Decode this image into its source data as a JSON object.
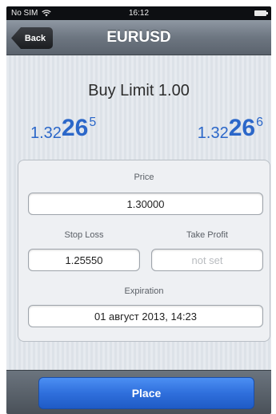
{
  "status_bar": {
    "carrier": "No SIM",
    "time": "16:12",
    "wifi_icon": "wifi-icon",
    "battery_icon": "battery-icon"
  },
  "nav": {
    "back_label": "Back",
    "title": "EURUSD"
  },
  "order": {
    "title": "Buy Limit 1.00"
  },
  "quotes": {
    "bid": {
      "base": "1.32",
      "big": "26",
      "sup": "5"
    },
    "ask": {
      "base": "1.32",
      "big": "26",
      "sup": "6"
    },
    "color": "#2b67c9"
  },
  "form": {
    "price_label": "Price",
    "price_value": "1.30000",
    "stop_loss_label": "Stop Loss",
    "stop_loss_value": "1.25550",
    "take_profit_label": "Take Profit",
    "take_profit_placeholder": "not set",
    "expiration_label": "Expiration",
    "expiration_value": "01 август 2013, 14:23"
  },
  "actions": {
    "place_label": "Place",
    "accent": "#2f6fdc"
  }
}
